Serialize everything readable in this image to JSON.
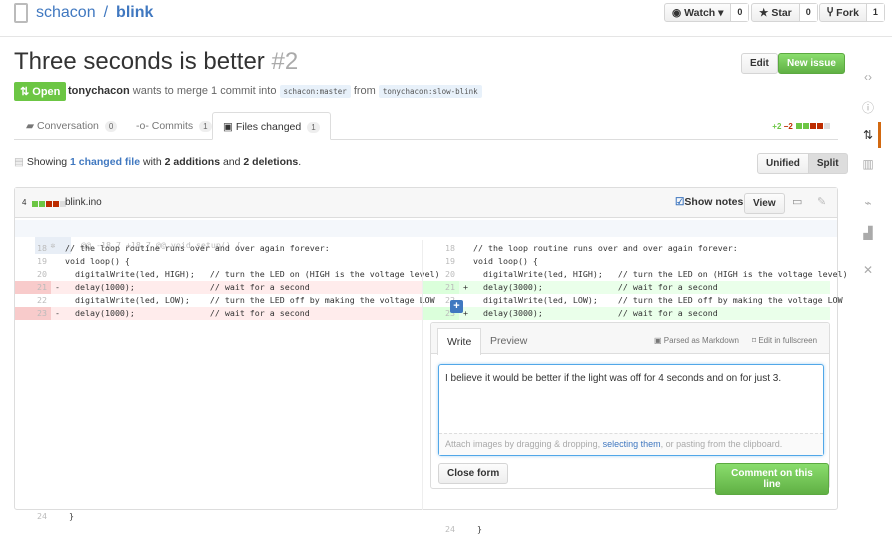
{
  "repo": {
    "owner": "schacon",
    "sep": "/",
    "name": "blink"
  },
  "header_buttons": [
    {
      "label": "Watch ▾",
      "count": "0",
      "icon": "eye-icon"
    },
    {
      "label": "Star",
      "count": "0",
      "icon": "star-icon"
    },
    {
      "label": "Fork",
      "count": "1",
      "icon": "fork-icon"
    }
  ],
  "pr": {
    "title": "Three seconds is better",
    "number": "#2",
    "state": "Open",
    "author": "tonychacon",
    "merge_text": "wants to merge 1 commit into",
    "base": "schacon:master",
    "from": "from",
    "head": "tonychacon:slow-blink",
    "edit": "Edit",
    "new_issue": "New issue"
  },
  "tabs": [
    {
      "label": "Conversation",
      "count": "0"
    },
    {
      "label": "Commits",
      "count": "1"
    },
    {
      "label": "Files changed",
      "count": "1"
    }
  ],
  "stats": {
    "additions": "+2",
    "deletions": "−2"
  },
  "summary": {
    "showing": "Showing",
    "link": "1 changed file",
    "with": "with",
    "additions": "2 additions",
    "and": "and",
    "deletions": "2 deletions",
    "end": "."
  },
  "view_toggle": {
    "unified": "Unified",
    "split": "Split"
  },
  "file": {
    "changes": "4",
    "name": "blink.ino",
    "show_notes": "Show notes",
    "view": "View",
    "hunk": "@@ -18,7 +18,7 @@ void setup() {"
  },
  "left_lines": [
    {
      "n": "18",
      "t": "  // the loop routine runs over and over again forever:",
      "type": "ctx"
    },
    {
      "n": "19",
      "t": "  void loop() {",
      "type": "ctx"
    },
    {
      "n": "20",
      "t": "    digitalWrite(led, HIGH);   // turn the LED on (HIGH is the voltage level)",
      "type": "ctx"
    },
    {
      "n": "21",
      "t": "-   delay(1000);               // wait for a second",
      "type": "del"
    },
    {
      "n": "22",
      "t": "    digitalWrite(led, LOW);    // turn the LED off by making the voltage LOW",
      "type": "ctx"
    },
    {
      "n": "23",
      "t": "-   delay(1000);               // wait for a second",
      "type": "del"
    }
  ],
  "right_lines": [
    {
      "n": "18",
      "t": "  // the loop routine runs over and over again forever:",
      "type": "ctx"
    },
    {
      "n": "19",
      "t": "  void loop() {",
      "type": "ctx"
    },
    {
      "n": "20",
      "t": "    digitalWrite(led, HIGH);   // turn the LED on (HIGH is the voltage level)",
      "type": "ctx"
    },
    {
      "n": "21",
      "t": "+   delay(3000);               // wait for a second",
      "type": "add"
    },
    {
      "n": "22",
      "t": "    digitalWrite(led, LOW);    // turn the LED off by making the voltage LOW",
      "type": "ctx"
    },
    {
      "n": "23",
      "t": "+   delay(3000);               // wait for a second",
      "type": "add"
    }
  ],
  "last_line": {
    "n": "24",
    "t": "  }"
  },
  "comment_form": {
    "write": "Write",
    "preview": "Preview",
    "markdown": "Parsed as Markdown",
    "fullscreen": "Edit in fullscreen",
    "text": "I believe it would be better if the light was off for 4 seconds and on for just 3.",
    "attach_pre": "Attach images by dragging & dropping, ",
    "attach_link": "selecting them",
    "attach_post": ", or pasting from the clipboard.",
    "close": "Close form",
    "submit": "Comment on this line"
  },
  "colors": {
    "green": "#6cc644",
    "red": "#bd2c00",
    "link": "#4078c0",
    "accent": "#d26911"
  }
}
